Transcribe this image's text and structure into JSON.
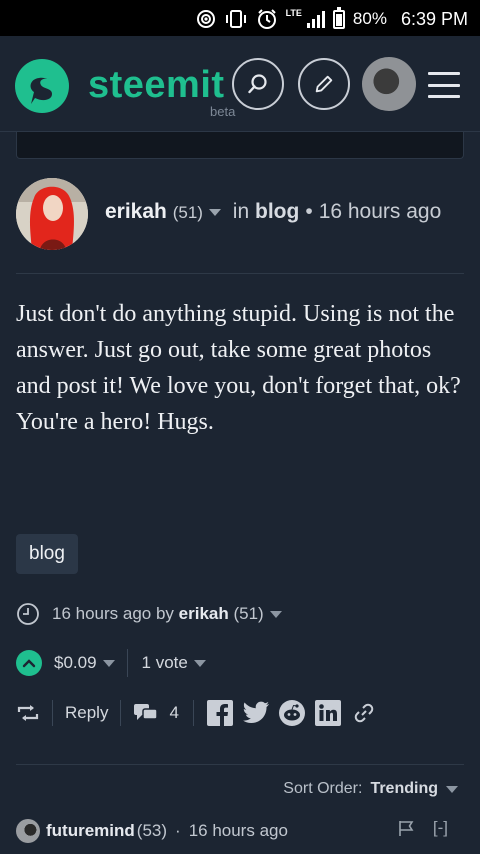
{
  "status_bar": {
    "battery": "80%",
    "time": "6:39 PM",
    "network": "LTE"
  },
  "header": {
    "brand": "steemit",
    "beta_label": "beta",
    "icons": [
      "search-icon",
      "pencil-icon",
      "avatar",
      "menu-icon"
    ],
    "accent_color": "#1fbf8f"
  },
  "post": {
    "author": "erikah",
    "reputation": "(51)",
    "in_label": "in",
    "category": "blog",
    "time_ago": "16 hours ago",
    "body": "Just don't do anything stupid. Using is not the answer. Just go out, take some great photos and post it! We love you, don't forget that, ok? You're a hero! Hugs.",
    "tag": "blog",
    "meta_time": "16 hours ago by",
    "meta_author": "erikah",
    "meta_rep": "(51)",
    "payout": "$0.09",
    "votes": "1 vote",
    "reply_label": "Reply",
    "reply_count": "4",
    "share_icons": [
      "facebook-icon",
      "twitter-icon",
      "reddit-icon",
      "linkedin-icon",
      "link-icon"
    ]
  },
  "comments": {
    "sort_label": "Sort Order:",
    "sort_value": "Trending",
    "first": {
      "author": "futuremind",
      "reputation": "(53)",
      "time_ago": "16 hours ago",
      "collapse": "[-]"
    }
  }
}
